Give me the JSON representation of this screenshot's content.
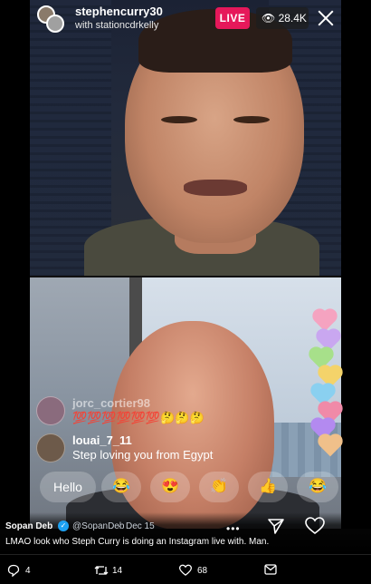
{
  "live": {
    "host_username": "stephencurry30",
    "guest_line": "with stationcdrkelly",
    "live_label": "LIVE",
    "viewer_count": "28.4K"
  },
  "comments": [
    {
      "username": "jorc_cortier98",
      "text": "💯💯💯💯💯💯🤔🤔🤔",
      "faded": true
    },
    {
      "username": "louai_7_11",
      "text": "Step loving you from Egypt",
      "faded": false
    }
  ],
  "reactions": {
    "hello_label": "Hello",
    "emojis": [
      "😂",
      "😍",
      "👏",
      "👍",
      "😂"
    ]
  },
  "more_label": "•••",
  "tweet": {
    "author_name": "Sopan Deb",
    "verified": "✓",
    "handle": "@SopanDeb",
    "separator": "·",
    "date": "Dec 15",
    "text": "LMAO look who Steph Curry is doing an Instagram live with. Man."
  },
  "actions": {
    "replies": "4",
    "retweets": "14",
    "likes": "68"
  },
  "colors": {
    "live_badge": "#e6185a",
    "verified_blue": "#1da1f2",
    "hearts": [
      "#f5a3c0",
      "#c9a7f0",
      "#a7e08a",
      "#f4d36a",
      "#8ad0f0",
      "#f08aa8",
      "#b38af0",
      "#f0c08a"
    ]
  }
}
